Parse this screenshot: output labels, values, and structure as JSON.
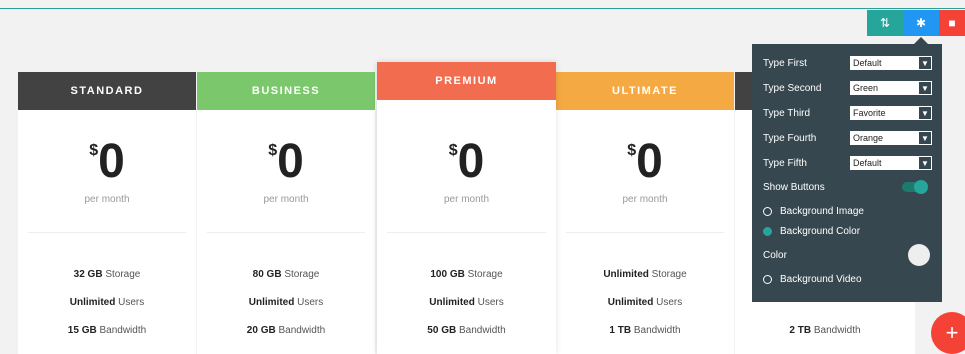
{
  "toolbar": {
    "move_icon": "move-icon",
    "settings_icon": "gear-icon",
    "delete_icon": "trash-icon"
  },
  "plans": [
    {
      "name": "STANDARD",
      "color": "#424242",
      "currency": "$",
      "price": "0",
      "period": "per month",
      "features": [
        {
          "value": "32 GB",
          "label": "Storage"
        },
        {
          "value": "Unlimited",
          "label": "Users"
        },
        {
          "value": "15 GB",
          "label": "Bandwidth"
        }
      ]
    },
    {
      "name": "BUSINESS",
      "color": "#7bc86c",
      "currency": "$",
      "price": "0",
      "period": "per month",
      "features": [
        {
          "value": "80 GB",
          "label": "Storage"
        },
        {
          "value": "Unlimited",
          "label": "Users"
        },
        {
          "value": "20 GB",
          "label": "Bandwidth"
        }
      ]
    },
    {
      "name": "PREMIUM",
      "color": "#f26c4f",
      "currency": "$",
      "price": "0",
      "period": "per month",
      "features": [
        {
          "value": "100 GB",
          "label": "Storage"
        },
        {
          "value": "Unlimited",
          "label": "Users"
        },
        {
          "value": "50 GB",
          "label": "Bandwidth"
        }
      ]
    },
    {
      "name": "ULTIMATE",
      "color": "#f5a942",
      "currency": "$",
      "price": "0",
      "period": "per month",
      "features": [
        {
          "value": "Unlimited",
          "label": "Storage"
        },
        {
          "value": "Unlimited",
          "label": "Users"
        },
        {
          "value": "1 TB",
          "label": "Bandwidth"
        }
      ]
    },
    {
      "name": "",
      "color": "#424242",
      "currency": "",
      "price": "",
      "period": "",
      "features": [
        {
          "value": "",
          "label": ""
        },
        {
          "value": "",
          "label": ""
        },
        {
          "value": "2 TB",
          "label": "Bandwidth"
        }
      ]
    }
  ],
  "settings": {
    "type_first": {
      "label": "Type First",
      "value": "Default"
    },
    "type_second": {
      "label": "Type Second",
      "value": "Green"
    },
    "type_third": {
      "label": "Type Third",
      "value": "Favorite"
    },
    "type_fourth": {
      "label": "Type Fourth",
      "value": "Orange"
    },
    "type_fifth": {
      "label": "Type Fifth",
      "value": "Default"
    },
    "show_buttons": {
      "label": "Show Buttons",
      "on": true
    },
    "background_image": "Background Image",
    "background_color": "Background Color",
    "color_label": "Color",
    "color_value": "#eeeeee",
    "background_video": "Background Video"
  },
  "fab_symbol": "+"
}
